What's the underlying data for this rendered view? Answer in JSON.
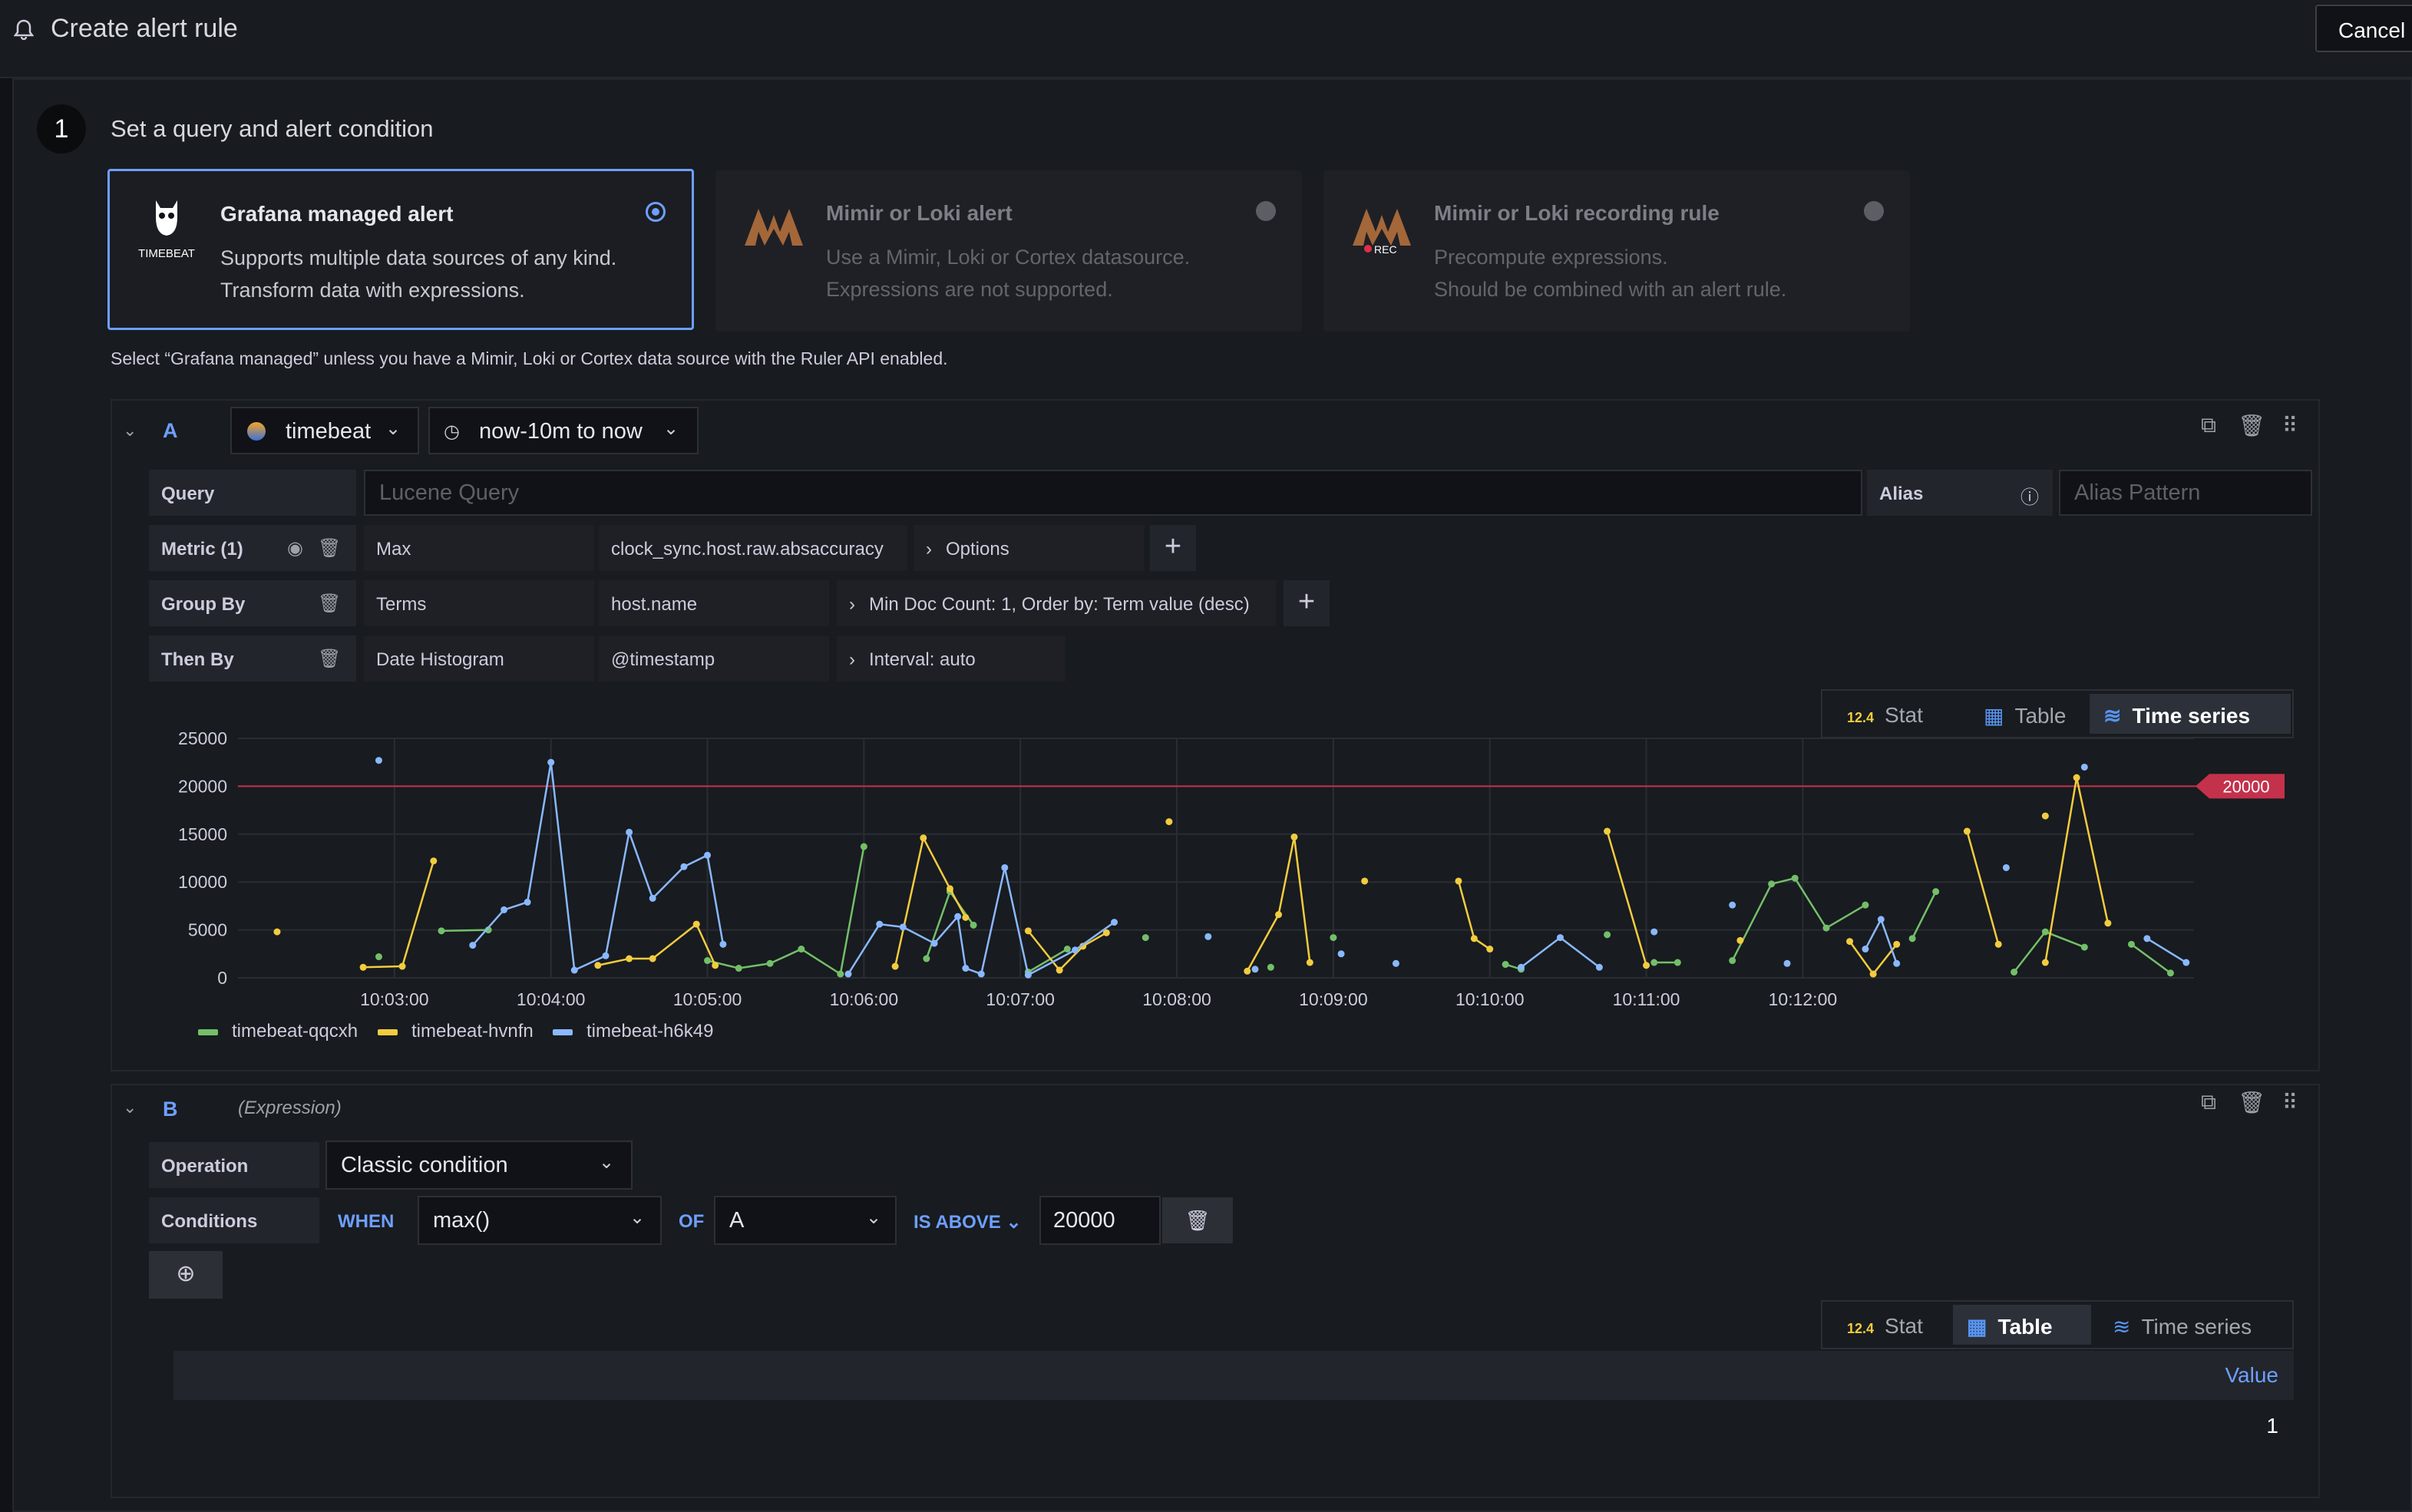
{
  "header": {
    "title": "Create alert rule",
    "cancel_label": "Cancel"
  },
  "step": {
    "number": "1",
    "title": "Set a query and alert condition"
  },
  "alert_types": [
    {
      "title": "Grafana managed alert",
      "line1": "Supports multiple data sources of any kind.",
      "line2": "Transform data with expressions.",
      "selected": true,
      "logo_text": "TIMEBEAT"
    },
    {
      "title": "Mimir or Loki alert",
      "line1": "Use a Mimir, Loki or Cortex datasource.",
      "line2": "Expressions are not supported.",
      "selected": false
    },
    {
      "title": "Mimir or Loki recording rule",
      "line1": "Precompute expressions.",
      "line2": "Should be combined with an alert rule.",
      "selected": false,
      "badge": "REC"
    }
  ],
  "hint": "Select “Grafana managed” unless you have a Mimir, Loki or Cortex data source with the Ruler API enabled.",
  "query_a": {
    "ref": "A",
    "datasource": "timebeat",
    "time_range": "now-10m to now",
    "query_label": "Query",
    "query_placeholder": "Lucene Query",
    "alias_label": "Alias",
    "alias_placeholder": "Alias Pattern",
    "metric_label": "Metric (1)",
    "metric_type": "Max",
    "metric_field": "clock_sync.host.raw.absaccuracy",
    "options_label": "Options",
    "groupby_label": "Group By",
    "groupby_type": "Terms",
    "groupby_field": "host.name",
    "groupby_opts": "Min Doc Count: 1, Order by: Term value (desc)",
    "thenby_label": "Then By",
    "thenby_type": "Date Histogram",
    "thenby_field": "@timestamp",
    "thenby_opts": "Interval: auto",
    "views": {
      "stat": "Stat",
      "table": "Table",
      "timeseries": "Time series",
      "stat_icon": "12.4"
    }
  },
  "chart_data": {
    "type": "line",
    "title": "",
    "x_ticks": [
      "10:03:00",
      "10:04:00",
      "10:05:00",
      "10:06:00",
      "10:07:00",
      "10:08:00",
      "10:09:00",
      "10:10:00",
      "10:11:00",
      "10:12:00"
    ],
    "y_ticks": [
      "0",
      "5000",
      "10000",
      "15000",
      "20000",
      "25000"
    ],
    "ylim": [
      0,
      25000
    ],
    "threshold": {
      "value": 20000,
      "label": "20000",
      "color": "#c4314b"
    },
    "series": [
      {
        "name": "timebeat-qqcxh",
        "color": "#73bf69",
        "points": [
          [
            10.9,
            2200
          ],
          [
            11.3,
            4900
          ],
          [
            11.6,
            5000
          ],
          [
            13.0,
            1800
          ],
          [
            13.2,
            1000
          ],
          [
            13.4,
            1500
          ],
          [
            13.6,
            3000
          ],
          [
            13.85,
            400
          ],
          [
            14.0,
            13700
          ],
          [
            14.4,
            2000
          ],
          [
            14.55,
            9000
          ],
          [
            14.7,
            5500
          ],
          [
            15.05,
            600
          ],
          [
            15.3,
            3000
          ],
          [
            15.8,
            4200
          ],
          [
            16.6,
            1100
          ],
          [
            17.0,
            4200
          ],
          [
            18.1,
            1400
          ],
          [
            18.2,
            900
          ],
          [
            18.75,
            4500
          ],
          [
            19.05,
            1600
          ],
          [
            19.2,
            1600
          ],
          [
            19.55,
            1800
          ],
          [
            19.8,
            9800
          ],
          [
            19.95,
            10400
          ],
          [
            20.15,
            5200
          ],
          [
            20.4,
            7600
          ],
          [
            20.7,
            4100
          ],
          [
            20.85,
            9000
          ],
          [
            21.35,
            600
          ],
          [
            21.55,
            4800
          ],
          [
            21.8,
            3200
          ],
          [
            22.1,
            3500
          ],
          [
            22.35,
            500
          ]
        ]
      },
      {
        "name": "timebeat-hvnfn",
        "color": "#f2cc3f",
        "points": [
          [
            10.25,
            4800
          ],
          [
            10.8,
            1100
          ],
          [
            11.05,
            1200
          ],
          [
            11.25,
            12200
          ],
          [
            12.3,
            1300
          ],
          [
            12.5,
            2000
          ],
          [
            12.65,
            2000
          ],
          [
            12.93,
            5600
          ],
          [
            13.05,
            1300
          ],
          [
            14.2,
            1200
          ],
          [
            14.38,
            14600
          ],
          [
            14.55,
            9300
          ],
          [
            14.65,
            6300
          ],
          [
            15.05,
            4900
          ],
          [
            15.25,
            800
          ],
          [
            15.4,
            3300
          ],
          [
            15.55,
            4700
          ],
          [
            15.95,
            16300
          ],
          [
            16.45,
            700
          ],
          [
            16.65,
            6600
          ],
          [
            16.75,
            14700
          ],
          [
            16.85,
            1600
          ],
          [
            17.2,
            10100
          ],
          [
            17.8,
            10100
          ],
          [
            17.9,
            4100
          ],
          [
            18.0,
            3000
          ],
          [
            18.75,
            15300
          ],
          [
            19.0,
            1300
          ],
          [
            19.6,
            3900
          ],
          [
            20.3,
            3800
          ],
          [
            20.45,
            400
          ],
          [
            20.6,
            3500
          ],
          [
            21.05,
            15300
          ],
          [
            21.25,
            3500
          ],
          [
            21.55,
            16900
          ],
          [
            21.55,
            1600
          ],
          [
            21.75,
            20900
          ],
          [
            21.95,
            5700
          ]
        ]
      },
      {
        "name": "timebeat-h6k49",
        "color": "#8ab8ff",
        "points": [
          [
            10.9,
            22700
          ],
          [
            11.5,
            3400
          ],
          [
            11.7,
            7100
          ],
          [
            11.85,
            7900
          ],
          [
            12.0,
            22500
          ],
          [
            12.15,
            800
          ],
          [
            12.35,
            2300
          ],
          [
            12.5,
            15200
          ],
          [
            12.65,
            8300
          ],
          [
            12.85,
            11600
          ],
          [
            13.0,
            12800
          ],
          [
            13.1,
            3500
          ],
          [
            13.9,
            400
          ],
          [
            14.1,
            5600
          ],
          [
            14.25,
            5300
          ],
          [
            14.45,
            3600
          ],
          [
            14.6,
            6400
          ],
          [
            14.65,
            1000
          ],
          [
            14.75,
            400
          ],
          [
            14.9,
            11500
          ],
          [
            15.05,
            300
          ],
          [
            15.35,
            2900
          ],
          [
            15.6,
            5800
          ],
          [
            16.2,
            4300
          ],
          [
            16.5,
            900
          ],
          [
            17.05,
            2500
          ],
          [
            17.4,
            1500
          ],
          [
            18.2,
            1100
          ],
          [
            18.45,
            4200
          ],
          [
            18.7,
            1100
          ],
          [
            19.05,
            4800
          ],
          [
            19.55,
            7600
          ],
          [
            19.9,
            1500
          ],
          [
            20.4,
            3000
          ],
          [
            20.5,
            6100
          ],
          [
            20.6,
            1500
          ],
          [
            21.3,
            11500
          ],
          [
            21.8,
            22000
          ],
          [
            22.2,
            4100
          ],
          [
            22.45,
            1600
          ]
        ]
      }
    ],
    "legend": [
      "timebeat-qqcxh",
      "timebeat-hvnfn",
      "timebeat-h6k49"
    ]
  },
  "expression_b": {
    "ref": "B",
    "subtitle": "(Expression)",
    "operation_label": "Operation",
    "operation_value": "Classic condition",
    "conditions_label": "Conditions",
    "when": "WHEN",
    "func": "max()",
    "of": "OF",
    "query": "A",
    "is_above": "IS ABOVE",
    "threshold": "20000",
    "views": {
      "stat": "Stat",
      "table": "Table",
      "timeseries": "Time series",
      "stat_icon": "12.4"
    },
    "table_header": "Value",
    "table_value": "1"
  }
}
